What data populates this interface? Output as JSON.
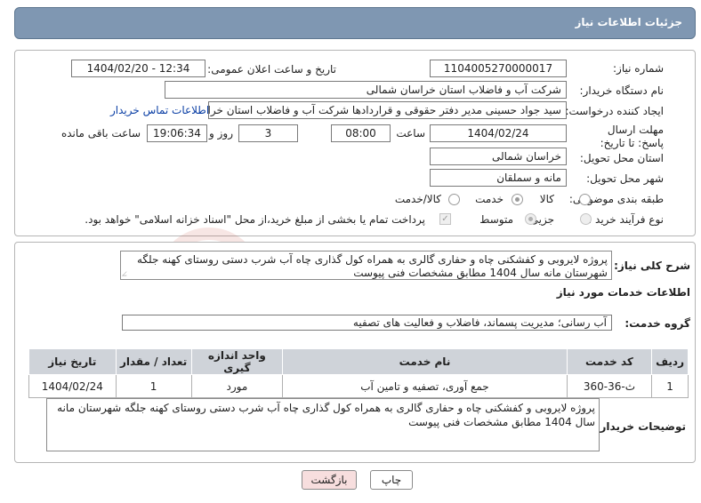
{
  "header": {
    "title": "جزئیات اطلاعات نیاز"
  },
  "form": {
    "need_number_label": "شماره نیاز:",
    "need_number": "1104005270000017",
    "announce_label": "تاریخ و ساعت اعلان عمومی:",
    "announce_value": "1404/02/20 - 12:34",
    "buyer_label": "نام دستگاه خریدار:",
    "buyer_value": "شرکت آب و فاضلاب استان خراسان شمالی",
    "creator_label": "ایجاد کننده درخواست:",
    "creator_value": "سید جواد حسینی مدیر دفتر حقوقی و قراردادها  شرکت آب و فاضلاب استان خراسان شمالی",
    "contact_link": "اطلاعات تماس خریدار",
    "deadline_label": "مهلت ارسال پاسخ: تا تاریخ:",
    "deadline_date": "1404/02/24",
    "time_label": "ساعت",
    "deadline_time": "08:00",
    "days_value": "3",
    "days_label": "روز و",
    "remaining_time": "19:06:34",
    "remaining_label": "ساعت باقی مانده",
    "province_label": "استان محل تحویل:",
    "province_value": "خراسان شمالی",
    "city_label": "شهر محل تحویل:",
    "city_value": "مانه و سملقان",
    "category_label": "طبقه بندی موضوعی:",
    "category_options": [
      "کالا",
      "خدمت",
      "کالا/خدمت"
    ],
    "category_selected": "خدمت",
    "process_label": "نوع فرآیند خرید :",
    "process_options": [
      "جزیی",
      "متوسط"
    ],
    "process_selected": "متوسط",
    "payment_note": "پرداخت تمام یا بخشی از مبلغ خرید،از محل \"اسناد خزانه اسلامی\" خواهد بود."
  },
  "details": {
    "summary_label": "شرح کلی نیاز:",
    "summary_text": "پروژه لایروبی و کفشکنی چاه و حفاری گالری به همراه کول گذاری چاه آب شرب دستی روستای کهنه جلگه شهرستان مانه سال 1404 مطابق مشخصات فنی پیوست",
    "services_title": "اطلاعات خدمات مورد نیاز",
    "service_group_label": "گروه خدمت:",
    "service_group_value": "آب رسانی؛ مدیریت پسماند، فاضلاب و فعالیت های تصفیه",
    "table": {
      "headers": [
        "ردیف",
        "کد خدمت",
        "نام خدمت",
        "واحد اندازه گیری",
        "تعداد / مقدار",
        "تاریخ نیاز"
      ],
      "rows": [
        [
          "1",
          "ث-36-360",
          "جمع آوری، تصفیه و تامین آب",
          "مورد",
          "1",
          "1404/02/24"
        ]
      ]
    },
    "buyer_notes_label": "توضیحات خریدار:",
    "buyer_notes_text": "پروژه لایروبی و کفشکنی چاه و حفاری گالری به همراه کول گذاری چاه آب شرب دستی روستای کهنه جلگه شهرستان مانه سال 1404 مطابق مشخصات فنی پیوست"
  },
  "buttons": {
    "print": "چاپ",
    "back": "بازگشت"
  },
  "colors": {
    "title_bar": "#7f97b2",
    "link": "#0b3fa5",
    "back_button": "#f7dede",
    "table_header": "#cfd3d9"
  }
}
